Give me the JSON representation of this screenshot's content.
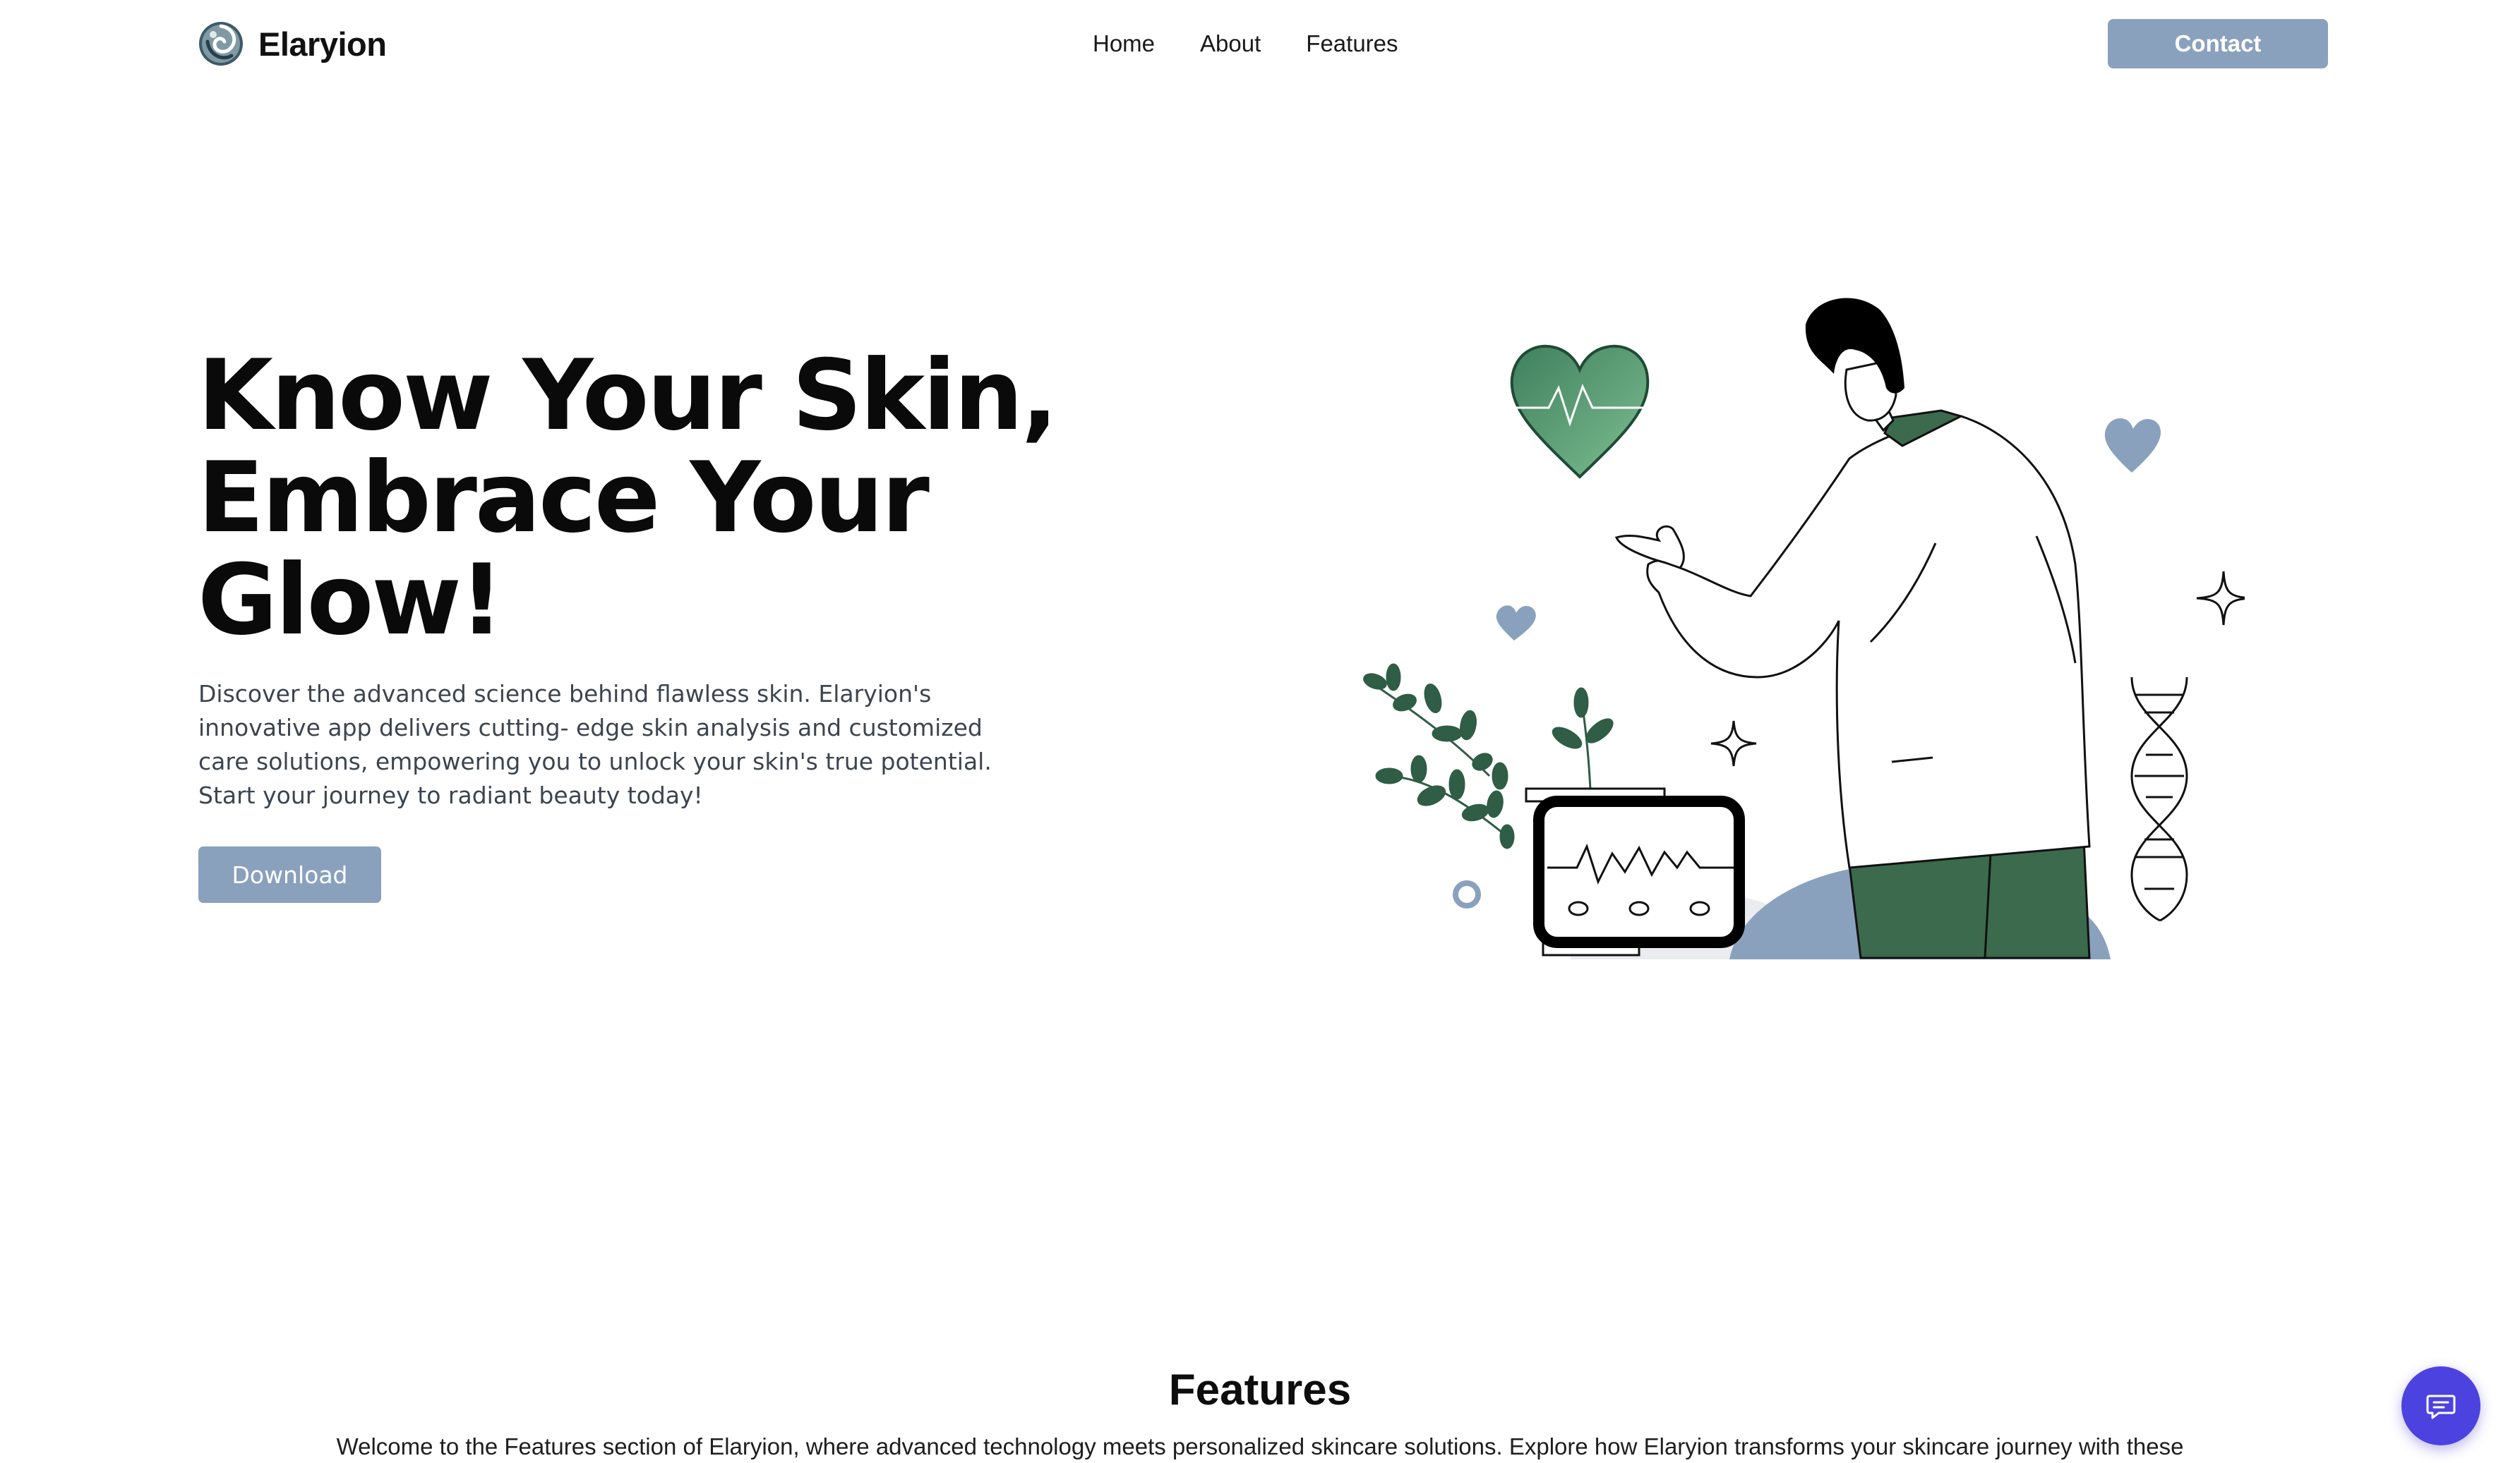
{
  "brand": {
    "name": "Elaryion",
    "logo_icon": "swirl-logo-icon"
  },
  "nav": {
    "links": [
      "Home",
      "About",
      "Features"
    ],
    "contact_label": "Contact"
  },
  "hero": {
    "title_line1": "Know Your Skin,",
    "title_line2": "Embrace Your",
    "title_line3": "Glow!",
    "description": "Discover the advanced science behind flawless skin. Elaryion's innovative app delivers cutting- edge skin analysis and customized care solutions, empowering you to unlock your skin's true potential. Start your journey to radiant beauty today!",
    "download_label": "Download",
    "illustration": "doctor-with-heart-monitor-illustration"
  },
  "features": {
    "title": "Features",
    "intro": "Welcome to the Features section of Elaryion, where advanced technology meets personalized skincare solutions. Explore how Elaryion transforms your skincare journey with these"
  },
  "chat": {
    "icon": "chat-bubble-icon"
  },
  "colors": {
    "accent": "#8aa1bd",
    "chat_button": "#4c42e0",
    "leaf_green": "#2f5d45",
    "heart_green": "#4a8f6a",
    "text_dark": "#0a0a0a",
    "text_muted": "#3d4450"
  }
}
